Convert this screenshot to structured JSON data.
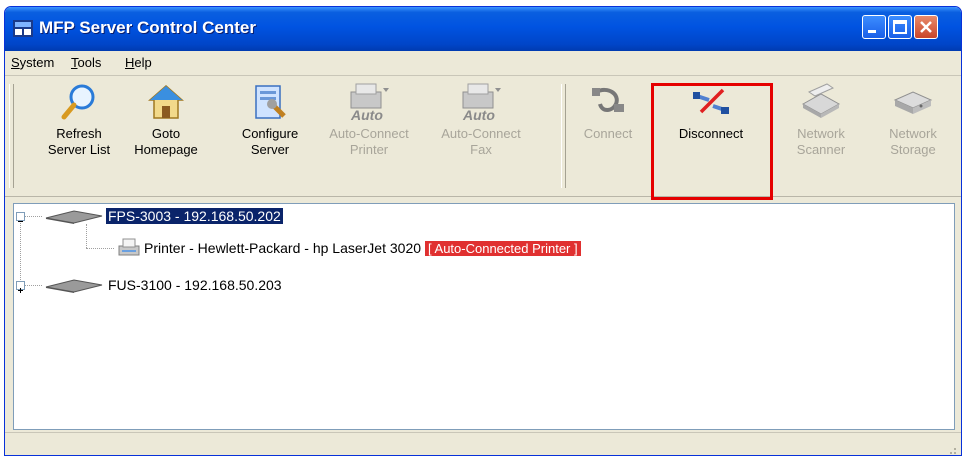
{
  "window": {
    "title": "MFP Server Control Center"
  },
  "menu": {
    "system": "System",
    "tools": "Tools",
    "help": "Help"
  },
  "toolbar": {
    "refresh": [
      "Refresh",
      "Server List"
    ],
    "goto": [
      "Goto",
      "Homepage"
    ],
    "configure": [
      "Configure",
      "Server"
    ],
    "auto_printer": [
      "Auto-Connect",
      "Printer"
    ],
    "auto_fax": [
      "Auto-Connect",
      "Fax"
    ],
    "auto_badge": "Auto",
    "connect": "Connect",
    "disconnect": "Disconnect",
    "scanner": [
      "Network",
      "Scanner"
    ],
    "storage": [
      "Network",
      "Storage"
    ]
  },
  "tree": {
    "server1": "FPS-3003 - 192.168.50.202",
    "printer": "Printer - Hewlett-Packard - hp LaserJet 3020",
    "printer_badge": "[ Auto-Connected Printer ]",
    "server2": "FUS-3100 - 192.168.50.203"
  },
  "colors": {
    "title_bar": "#0053e1",
    "highlight": "#e50000",
    "selection": "#0a246a",
    "badge": "#e03030"
  }
}
